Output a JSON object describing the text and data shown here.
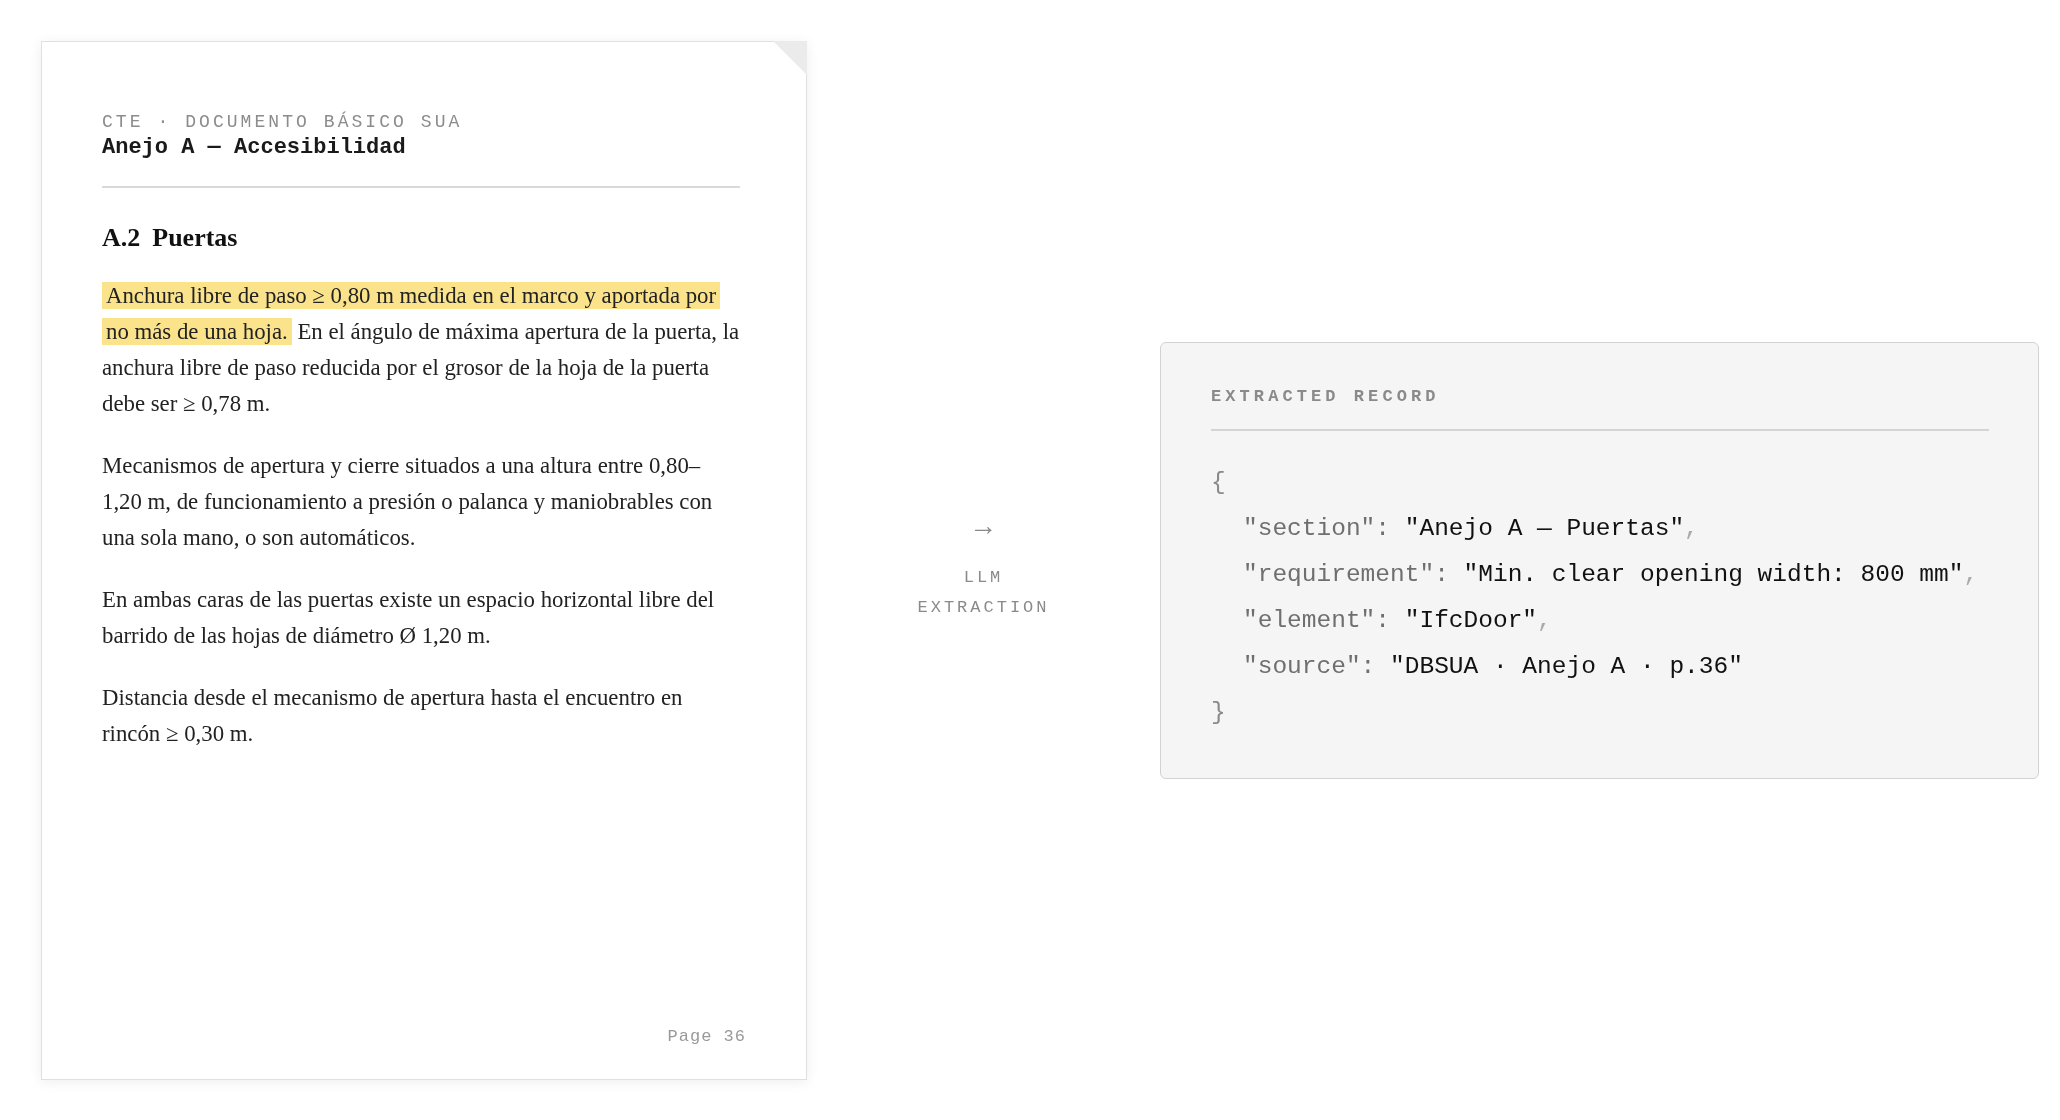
{
  "document": {
    "kicker": "CTE · DOCUMENTO BÁSICO SUA",
    "title": "Anejo A — Accesibilidad",
    "section": {
      "number": "A.2",
      "title": "Puertas"
    },
    "paragraphs": [
      {
        "segments": [
          {
            "text": "Anchura libre de paso ≥ 0,80 m medida en el marco y aportada por no más de una hoja.",
            "highlighted": true
          },
          {
            "text": "En el ángulo de máxima apertura de la puerta, la anchura libre de paso reducida por el grosor de la hoja de la puerta debe ser ≥ 0,78 m.",
            "highlighted": false
          }
        ]
      },
      {
        "segments": [
          {
            "text": "Mecanismos de apertura y cierre situados a una altura entre 0,80–1,20 m, de funcionamiento a presión o palanca y maniobrables con una sola mano, o son automáticos.",
            "highlighted": false
          }
        ]
      },
      {
        "segments": [
          {
            "text": "En ambas caras de las puertas existe un espacio horizontal libre del barrido de las hojas de diámetro Ø 1,20 m.",
            "highlighted": false
          }
        ]
      },
      {
        "segments": [
          {
            "text": "Distancia desde el mecanismo de apertura hasta el encuentro en rincón ≥ 0,30 m.",
            "highlighted": false
          }
        ]
      }
    ],
    "page_label": "Page 36"
  },
  "connector": {
    "arrow": "→",
    "label": "LLM EXTRACTION"
  },
  "record": {
    "title": "EXTRACTED RECORD",
    "open": "{",
    "fields": [
      {
        "key": "\"section\":",
        "value": "\"Anejo A — Puertas\"",
        "comma": ","
      },
      {
        "key": "\"requirement\":",
        "value": "\"Min. clear opening width: 800 mm\"",
        "comma": ","
      },
      {
        "key": "\"element\":",
        "value": "\"IfcDoor\"",
        "comma": ","
      },
      {
        "key": "\"source\":",
        "value": "\"DBSUA · Anejo A · p.36\""
      }
    ],
    "close": "}"
  }
}
